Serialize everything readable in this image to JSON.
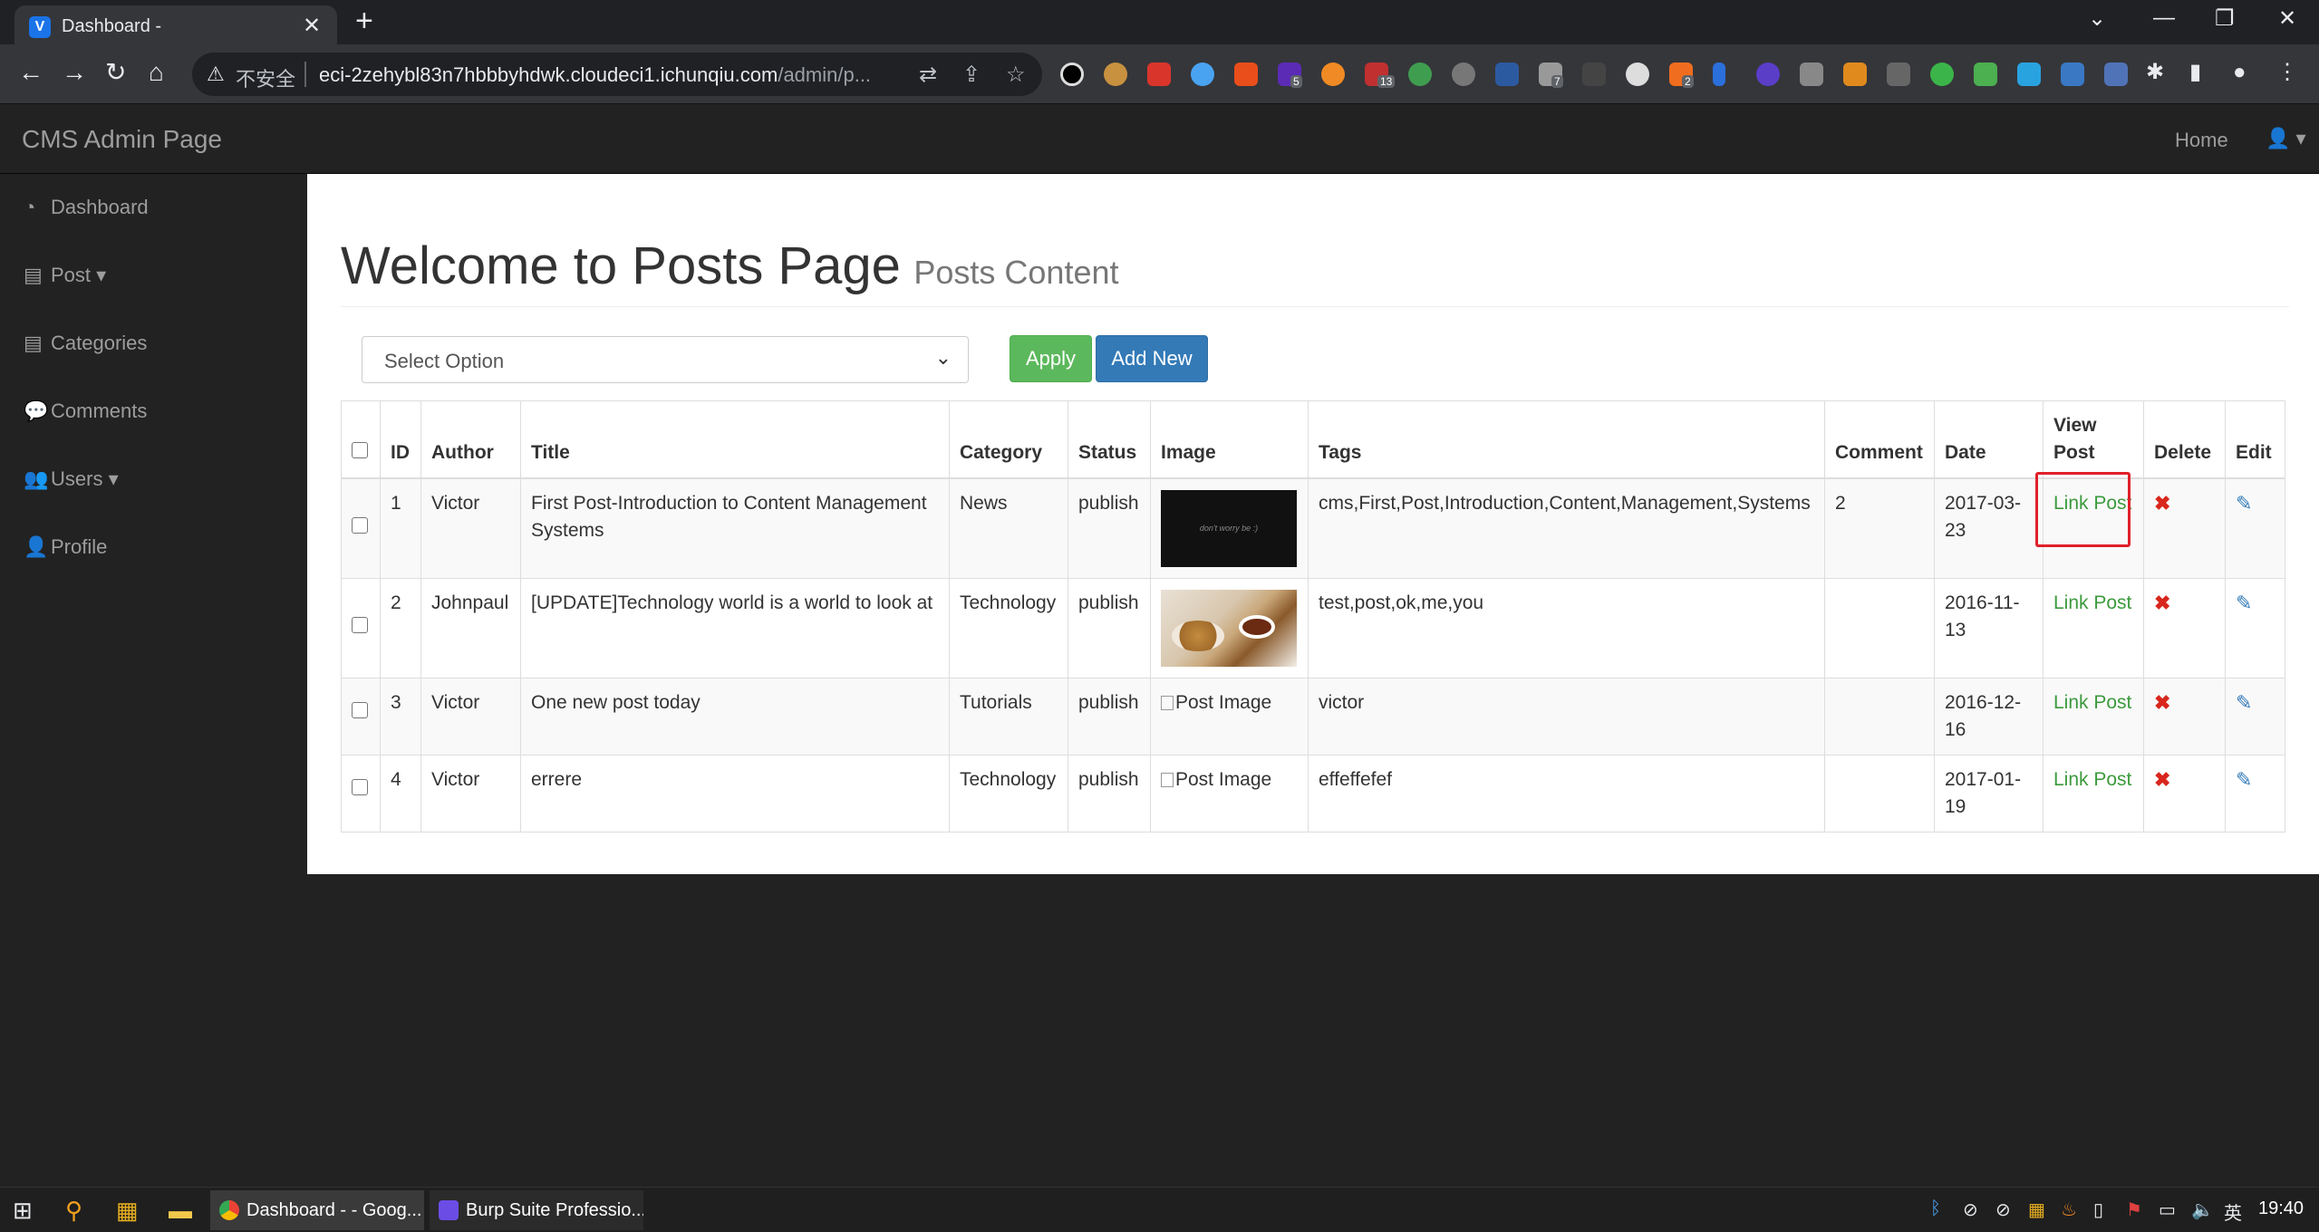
{
  "browser": {
    "tab_title": "Dashboard -",
    "tab_favicon": "V",
    "url_insecure_label": "不安全",
    "url_host": "eci-2zehybl83n7hbbbyhdwk.cloudeci1.ichunqiu.com",
    "url_path": "/admin/p..."
  },
  "cms_nav": {
    "brand": "CMS Admin Page",
    "home_link": "Home"
  },
  "sidebar": {
    "items": [
      {
        "label": "Dashboard",
        "icon": "dashboard-icon"
      },
      {
        "label": "Post",
        "icon": "file-icon"
      },
      {
        "label": "Categories",
        "icon": "file-icon"
      },
      {
        "label": "Comments",
        "icon": "comments-icon"
      },
      {
        "label": "Users",
        "icon": "users-icon"
      },
      {
        "label": "Profile",
        "icon": "user-icon"
      }
    ]
  },
  "main": {
    "heading": "Welcome to Posts Page",
    "subheading": "Posts Content",
    "select_value": "Select Option",
    "apply_label": "Apply",
    "add_new_label": "Add New",
    "columns": [
      "ID",
      "Author",
      "Title",
      "Category",
      "Status",
      "Image",
      "Tags",
      "Comment",
      "Date",
      "View Post",
      "Delete",
      "Edit"
    ],
    "rows": [
      {
        "id": "1",
        "author": "Victor",
        "title": "First Post-Introduction to Content Management Systems",
        "category": "News",
        "status": "publish",
        "image": "",
        "tags": "cms,First,Post,Introduction,Content,Management,Systems",
        "comment": "2",
        "date": "2017-03-23",
        "view": "Link Post"
      },
      {
        "id": "2",
        "author": "Johnpaul",
        "title": "[UPDATE]Technology world is a world to look at",
        "category": "Technology",
        "status": "publish",
        "image": "",
        "tags": "test,post,ok,me,you",
        "comment": "",
        "date": "2016-11-13",
        "view": "Link Post"
      },
      {
        "id": "3",
        "author": "Victor",
        "title": "One new post today",
        "category": "Tutorials",
        "status": "publish",
        "image": "Post Image",
        "tags": "victor",
        "comment": "",
        "date": "2016-12-16",
        "view": "Link Post"
      },
      {
        "id": "4",
        "author": "Victor",
        "title": "errere",
        "category": "Technology",
        "status": "publish",
        "image": "Post Image",
        "tags": "effeffefef",
        "comment": "",
        "date": "2017-01-19",
        "view": "Link Post"
      }
    ]
  },
  "taskbar": {
    "apps": [
      {
        "label": "Dashboard - - Goog..."
      },
      {
        "label": "Burp Suite Professio..."
      }
    ],
    "ime": "英",
    "time": "19:40"
  }
}
